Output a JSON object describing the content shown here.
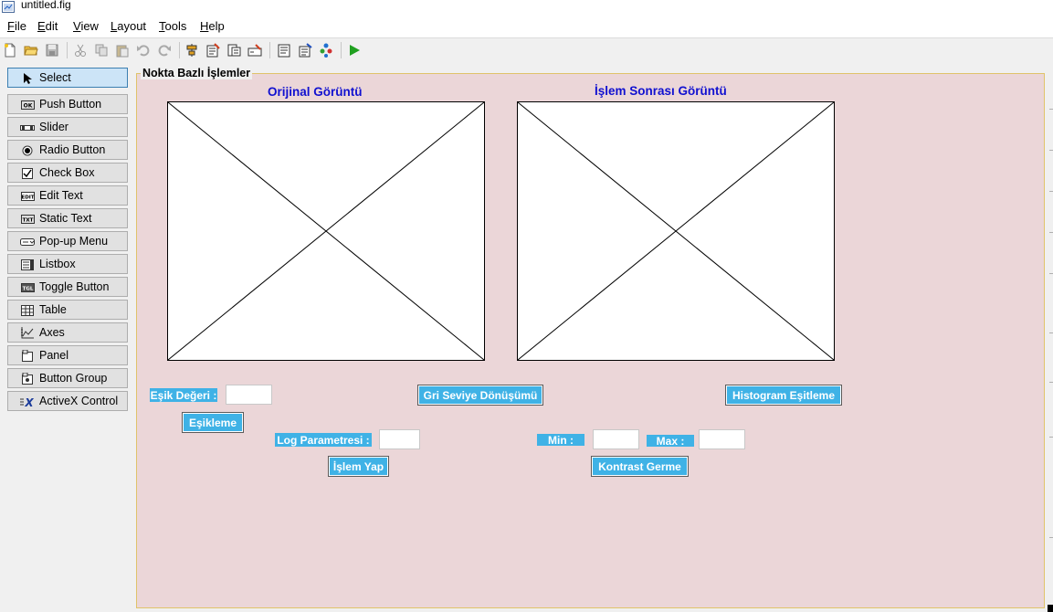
{
  "window": {
    "title": "untitled.fig"
  },
  "menu": [
    "File",
    "Edit",
    "View",
    "Layout",
    "Tools",
    "Help"
  ],
  "toolbar_icons": [
    "new-file-icon",
    "open-folder-icon",
    "save-icon",
    "cut-icon",
    "copy-icon",
    "paste-icon",
    "undo-icon",
    "redo-icon",
    "align-icon",
    "menu-editor-icon",
    "tab-order-icon",
    "toolbar-editor-icon",
    "editor-icon",
    "property-inspector-icon",
    "object-browser-icon",
    "run-icon"
  ],
  "palette": [
    {
      "label": "Select",
      "icon": "arrow-pointer-icon",
      "selected": true
    },
    {
      "label": "Push Button",
      "icon": "push-button-icon"
    },
    {
      "label": "Slider",
      "icon": "slider-icon"
    },
    {
      "label": "Radio Button",
      "icon": "radio-button-icon"
    },
    {
      "label": "Check Box",
      "icon": "checkbox-icon"
    },
    {
      "label": "Edit Text",
      "icon": "edit-text-icon"
    },
    {
      "label": "Static Text",
      "icon": "static-text-icon"
    },
    {
      "label": "Pop-up Menu",
      "icon": "popup-menu-icon"
    },
    {
      "label": "Listbox",
      "icon": "listbox-icon"
    },
    {
      "label": "Toggle Button",
      "icon": "toggle-button-icon"
    },
    {
      "label": "Table",
      "icon": "table-icon"
    },
    {
      "label": "Axes",
      "icon": "axes-icon"
    },
    {
      "label": "Panel",
      "icon": "panel-icon"
    },
    {
      "label": "Button Group",
      "icon": "button-group-icon"
    },
    {
      "label": "ActiveX Control",
      "icon": "activex-icon"
    }
  ],
  "panel": {
    "title": "Nokta Bazlı İşlemler",
    "axes_left_title": "Orijinal Görüntü",
    "axes_right_title": "İşlem Sonrası Görüntü",
    "esik_label": "Eşik Değeri :",
    "esik_value": "",
    "esikleme_button": "Eşikleme",
    "log_label": "Log Parametresi :",
    "log_value": "",
    "islem_yap_button": "İşlem Yap",
    "gri_button": "Gri Seviye Dönüşümü",
    "min_label": "Min :",
    "min_value": "",
    "max_label": "Max :",
    "max_value": "",
    "kontrast_button": "Kontrast Germe",
    "histogram_button": "Histogram Eşitleme"
  },
  "colors": {
    "panel_bg": "#ebd6d8",
    "panel_border": "#e0c36a",
    "label_bg": "#3fb2e6",
    "axes_title": "#1010d0",
    "selected_tool": "#cce4f7"
  }
}
